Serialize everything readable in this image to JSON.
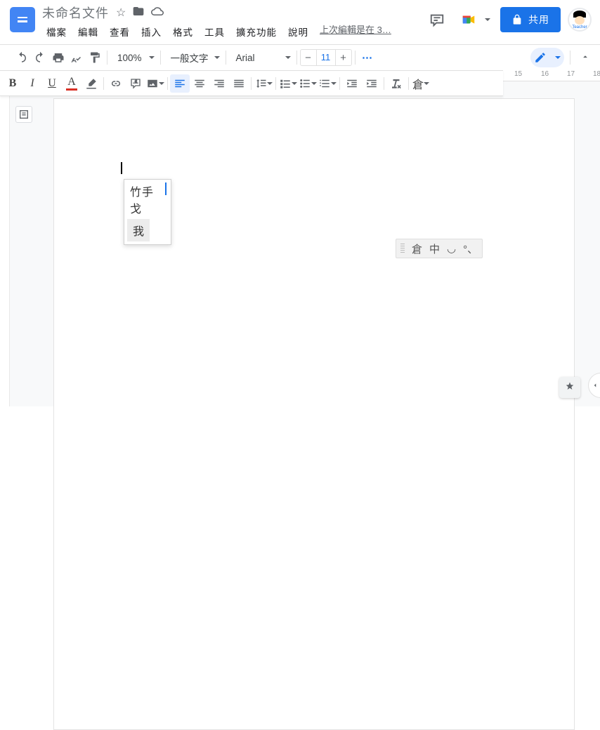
{
  "header": {
    "title": "未命名文件",
    "last_edit": "上次編輯是在 3…",
    "share": "共用"
  },
  "menu": {
    "file": "檔案",
    "edit": "編輯",
    "view": "查看",
    "insert": "插入",
    "format": "格式",
    "tools": "工具",
    "ext": "擴充功能",
    "help": "說明"
  },
  "toolbar": {
    "zoom": "100%",
    "style": "一般文字",
    "font": "Arial",
    "size": "11",
    "more": "⋯"
  },
  "ruler": {
    "n15": "15",
    "n16": "16",
    "n17": "17",
    "n18": "18"
  },
  "ime": {
    "input": "竹手戈",
    "candidate": "我"
  },
  "imebar": {
    "a": "倉",
    "b": "中",
    "c": "◡",
    "d": "°、"
  },
  "fmt": {
    "cangjie": "倉"
  }
}
